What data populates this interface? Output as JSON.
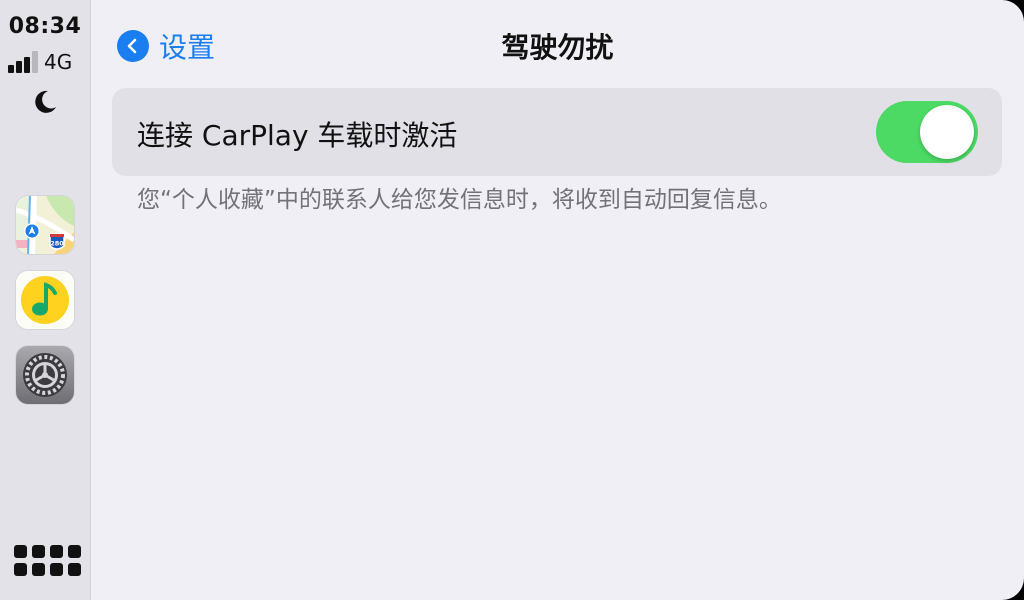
{
  "status": {
    "time": "08:34",
    "network": "4G"
  },
  "sidebar": {
    "apps": [
      {
        "name": "maps-app",
        "icon": "maps-icon",
        "badge": "280"
      },
      {
        "name": "qq-music-app",
        "icon": "music-note-icon"
      },
      {
        "name": "settings-app",
        "icon": "gear-icon"
      }
    ]
  },
  "header": {
    "back_label": "设置",
    "title": "驾驶勿扰"
  },
  "setting": {
    "label": "连接 CarPlay 车载时激活",
    "enabled": true,
    "description": "您“个人收藏”中的联系人给您发信息时，将收到自动回复信息。"
  },
  "colors": {
    "accent": "#1a7df0",
    "toggle_on": "#4cd964",
    "background": "#f0eff5",
    "sidebar": "#e2e2e8"
  }
}
